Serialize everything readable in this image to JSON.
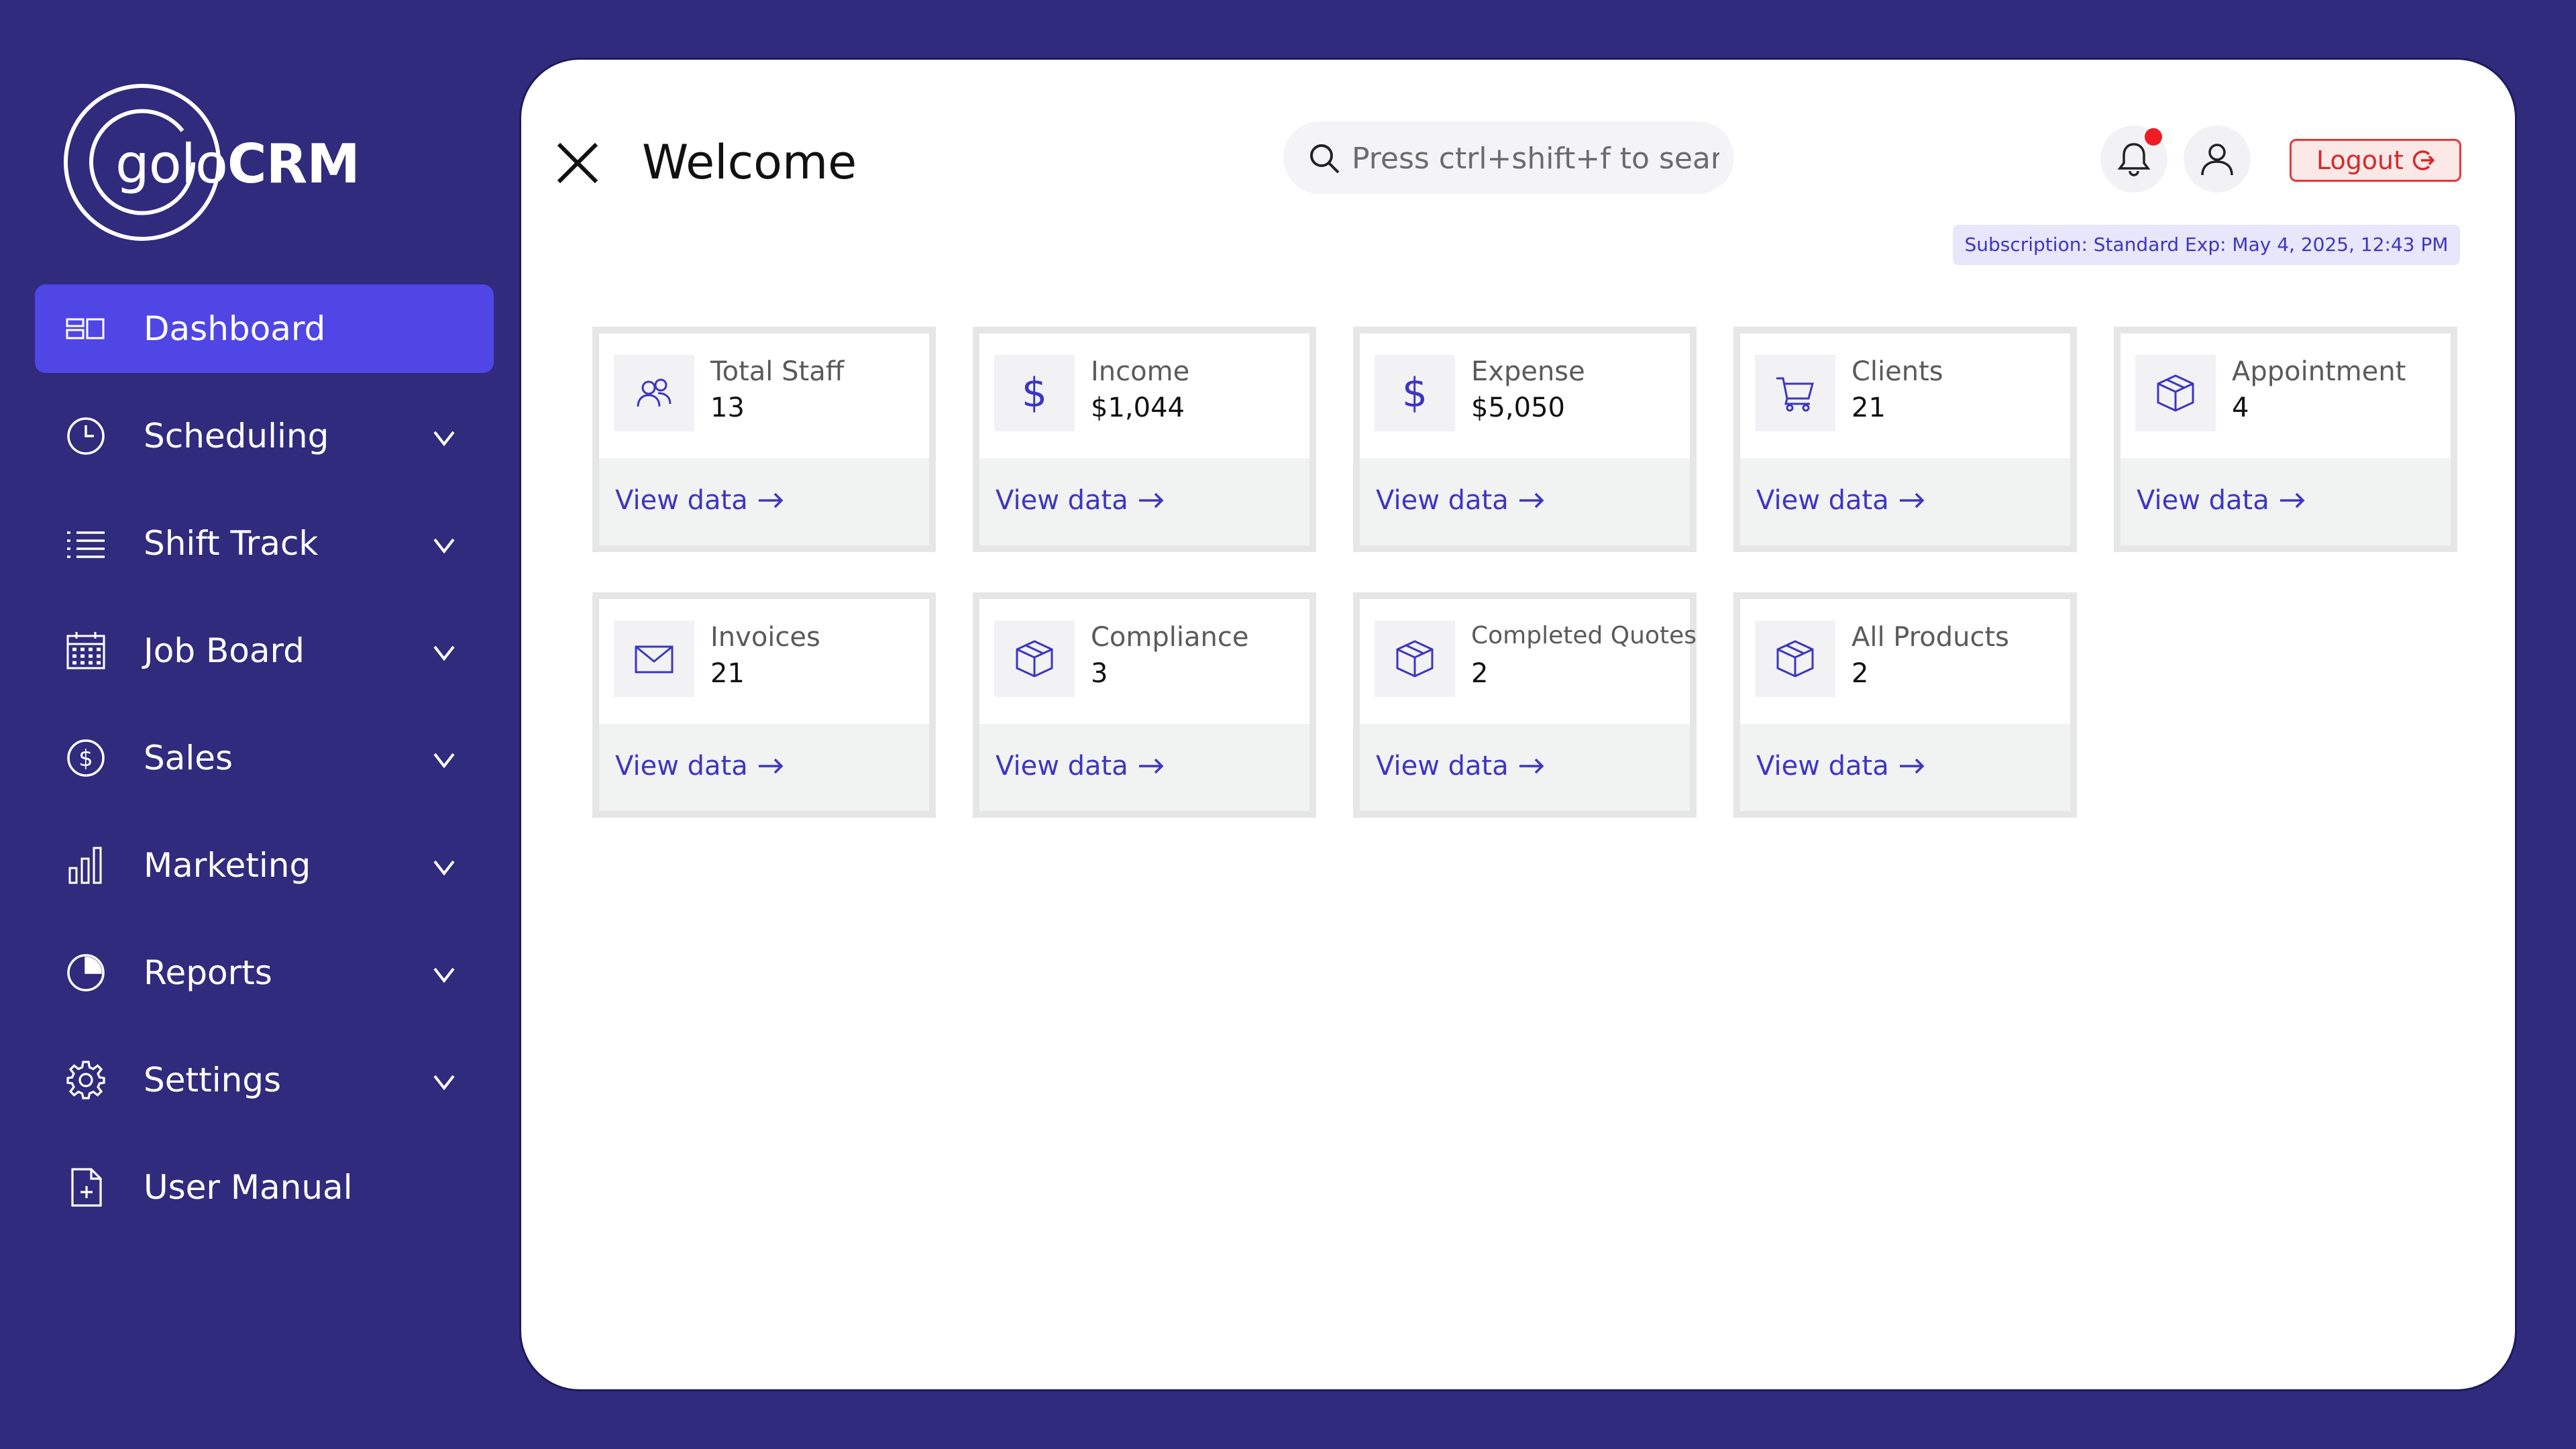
{
  "brand": {
    "prefix": "golo",
    "suffix": "CRM"
  },
  "sidebar": {
    "items": [
      {
        "label": "Dashboard",
        "icon": "dashboard-icon",
        "active": true
      },
      {
        "label": "Scheduling",
        "icon": "clock-icon",
        "expandable": true
      },
      {
        "label": "Shift Track",
        "icon": "list-icon",
        "expandable": true
      },
      {
        "label": "Job Board",
        "icon": "calendar-icon",
        "expandable": true
      },
      {
        "label": "Sales",
        "icon": "dollar-circle-icon",
        "expandable": true
      },
      {
        "label": "Marketing",
        "icon": "bar-chart-icon",
        "expandable": true
      },
      {
        "label": "Reports",
        "icon": "pie-chart-icon",
        "expandable": true
      },
      {
        "label": "Settings",
        "icon": "gear-icon",
        "expandable": true
      },
      {
        "label": "User Manual",
        "icon": "document-plus-icon"
      }
    ]
  },
  "header": {
    "title": "Welcome",
    "search_placeholder": "Press ctrl+shift+f to sear",
    "notification_badge": true,
    "logout_label": "Logout",
    "subscription": "Subscription: Standard Exp: May 4, 2025, 12:43 PM"
  },
  "cards": [
    {
      "title": "Total Staff",
      "value": "13",
      "icon": "users-icon",
      "link": "View data"
    },
    {
      "title": "Income",
      "value": "$1,044",
      "icon": "dollar-icon",
      "icon_glyph": "$",
      "link": "View data"
    },
    {
      "title": "Expense",
      "value": "$5,050",
      "icon": "dollar-icon",
      "icon_glyph": "$",
      "link": "View data"
    },
    {
      "title": "Clients",
      "value": "21",
      "icon": "cart-icon",
      "link": "View data"
    },
    {
      "title": "Appointment",
      "value": "4",
      "icon": "box-icon",
      "link": "View data"
    },
    {
      "title": "Invoices",
      "value": "21",
      "icon": "envelope-icon",
      "link": "View data"
    },
    {
      "title": "Compliance",
      "value": "3",
      "icon": "box-icon",
      "link": "View data"
    },
    {
      "title": "Completed Quotes",
      "value": "2",
      "icon": "box-icon",
      "link": "View data"
    },
    {
      "title": "All Products",
      "value": "2",
      "icon": "box-icon",
      "link": "View data"
    }
  ],
  "colors": {
    "background": "#302b7d",
    "accent": "#4f46e5",
    "link": "#3d36c0",
    "danger": "#e5383b",
    "notification": "#ee1c25"
  }
}
